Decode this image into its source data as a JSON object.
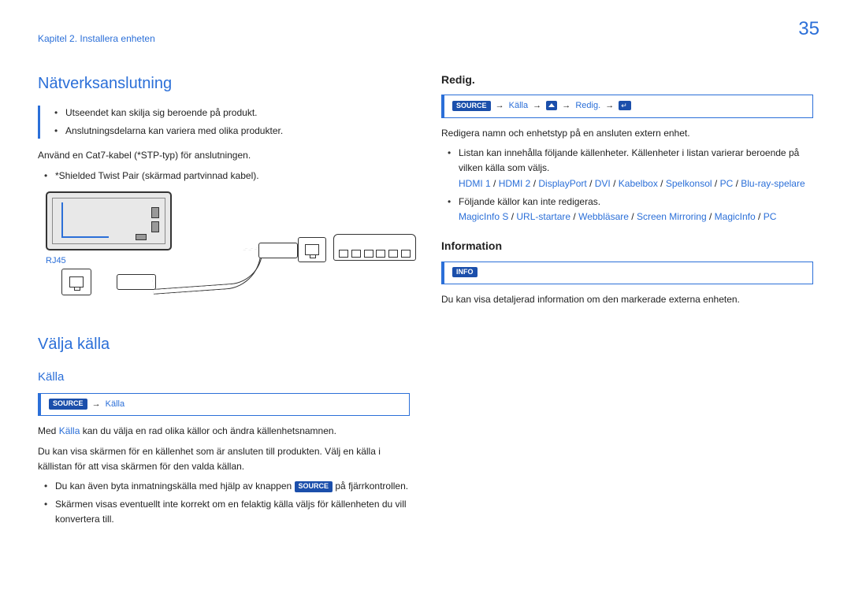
{
  "page_number": "35",
  "chapter": "Kapitel 2. Installera enheten",
  "left": {
    "h_network": "Nätverksanslutning",
    "note1": "Utseendet kan skilja sig beroende på produkt.",
    "note2": "Anslutningsdelarna kan variera med olika produkter.",
    "p1": "Använd en Cat7-kabel (*STP-typ) för anslutningen.",
    "b1": "*Shielded Twist Pair (skärmad partvinnad kabel).",
    "rj45": "RJ45",
    "h_select": "Välja källa",
    "h_kalla": "Källa",
    "bc_source": "SOURCE",
    "bc_kalla": "Källa",
    "p2a": "Med ",
    "p2link": "Källa",
    "p2b": " kan du välja en rad olika källor och ändra källenhetsnamnen.",
    "p3": "Du kan visa skärmen för en källenhet som är ansluten till produkten. Välj en källa i källistan för att visa skärmen för den valda källan.",
    "b2a": "Du kan även byta inmatningskälla med hjälp av knappen ",
    "b2tag": "SOURCE",
    "b2b": " på fjärrkontrollen.",
    "b3": "Skärmen visas eventuellt inte korrekt om en felaktig källa väljs för källenheten du vill konvertera till."
  },
  "right": {
    "h_redig": "Redig.",
    "bc_source": "SOURCE",
    "bc_kalla": "Källa",
    "bc_redig": "Redig.",
    "p1": "Redigera namn och enhetstyp på en ansluten extern enhet.",
    "b1": "Listan kan innehålla följande källenheter. Källenheter i listan varierar beroende på vilken källa som väljs.",
    "links1": [
      "HDMI 1",
      "HDMI 2",
      "DisplayPort",
      "DVI",
      "Kabelbox",
      "Spelkonsol",
      "PC",
      "Blu-ray-spelare"
    ],
    "b2": "Följande källor kan inte redigeras.",
    "links2": [
      "MagicInfo S",
      "URL-startare",
      "Webbläsare",
      "Screen Mirroring",
      "MagicInfo",
      "PC"
    ],
    "h_info": "Information",
    "info_tag": "INFO",
    "p2": "Du kan visa detaljerad information om den markerade externa enheten."
  }
}
